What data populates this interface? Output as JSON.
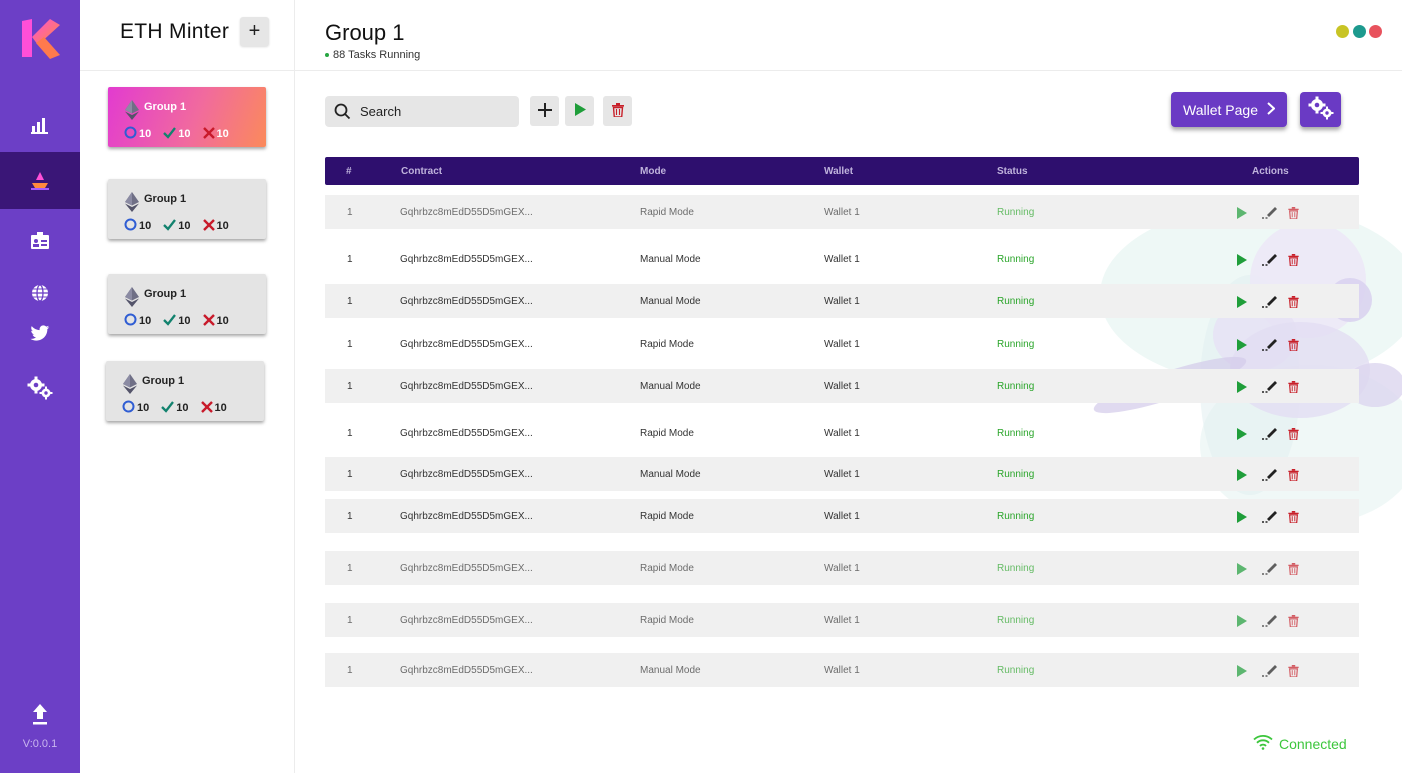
{
  "app": {
    "title": "ETH Minter",
    "add_group_label": "+",
    "version": "V:0.0.1"
  },
  "nav": {
    "items": [
      {
        "icon": "chart-icon"
      },
      {
        "icon": "mint-icon",
        "active": true
      },
      {
        "icon": "id-card-icon"
      },
      {
        "icon": "globe-icon"
      },
      {
        "icon": "twitter-icon"
      },
      {
        "icon": "gears-icon"
      }
    ],
    "bottom_icon": "upload-icon"
  },
  "groups": [
    {
      "name": "Group 1",
      "running": "10",
      "success": "10",
      "failed": "10",
      "active": true
    },
    {
      "name": "Group 1",
      "running": "10",
      "success": "10",
      "failed": "10"
    },
    {
      "name": "Group 1",
      "running": "10",
      "success": "10",
      "failed": "10"
    },
    {
      "name": "Group 1",
      "running": "10",
      "success": "10",
      "failed": "10"
    }
  ],
  "header": {
    "title": "Group 1",
    "subtitle": "88 Tasks Running",
    "window_dots": [
      "#c8c425",
      "#1d9a8e",
      "#e8525d"
    ]
  },
  "toolbar": {
    "search_placeholder": "Search",
    "add_label": "+",
    "wallet_page_label": "Wallet Page"
  },
  "table": {
    "columns": [
      "#",
      "Contract",
      "Mode",
      "Wallet",
      "Status",
      "Actions"
    ],
    "rows": [
      {
        "num": "1",
        "contract": "Gqhrbzc8mEdD55D5mGEX...",
        "mode": "Rapid Mode",
        "wallet": "Wallet 1",
        "status": "Running"
      },
      {
        "num": "1",
        "contract": "Gqhrbzc8mEdD55D5mGEX...",
        "mode": "Manual Mode",
        "wallet": "Wallet 1",
        "status": "Running"
      },
      {
        "num": "1",
        "contract": "Gqhrbzc8mEdD55D5mGEX...",
        "mode": "Manual Mode",
        "wallet": "Wallet 1",
        "status": "Running"
      },
      {
        "num": "1",
        "contract": "Gqhrbzc8mEdD55D5mGEX...",
        "mode": "Rapid Mode",
        "wallet": "Wallet 1",
        "status": "Running"
      },
      {
        "num": "1",
        "contract": "Gqhrbzc8mEdD55D5mGEX...",
        "mode": "Manual Mode",
        "wallet": "Wallet 1",
        "status": "Running"
      },
      {
        "num": "1",
        "contract": "Gqhrbzc8mEdD55D5mGEX...",
        "mode": "Rapid Mode",
        "wallet": "Wallet 1",
        "status": "Running"
      },
      {
        "num": "1",
        "contract": "Gqhrbzc8mEdD55D5mGEX...",
        "mode": "Manual Mode",
        "wallet": "Wallet 1",
        "status": "Running"
      },
      {
        "num": "1",
        "contract": "Gqhrbzc8mEdD55D5mGEX...",
        "mode": "Rapid Mode",
        "wallet": "Wallet 1",
        "status": "Running"
      },
      {
        "num": "1",
        "contract": "Gqhrbzc8mEdD55D5mGEX...",
        "mode": "Rapid Mode",
        "wallet": "Wallet 1",
        "status": "Running"
      },
      {
        "num": "1",
        "contract": "Gqhrbzc8mEdD55D5mGEX...",
        "mode": "Rapid Mode",
        "wallet": "Wallet 1",
        "status": "Running"
      },
      {
        "num": "1",
        "contract": "Gqhrbzc8mEdD55D5mGEX...",
        "mode": "Manual Mode",
        "wallet": "Wallet 1",
        "status": "Running"
      }
    ]
  },
  "footer": {
    "connection_status": "Connected"
  },
  "colors": {
    "sidebar": "#6c3fc6",
    "sidebar_active": "#3a1677",
    "table_header": "#2e0f6e",
    "accent_button": "#6a3ac4",
    "running": "#2aa52a",
    "play": "#1f9e3a",
    "delete": "#c8202a"
  }
}
